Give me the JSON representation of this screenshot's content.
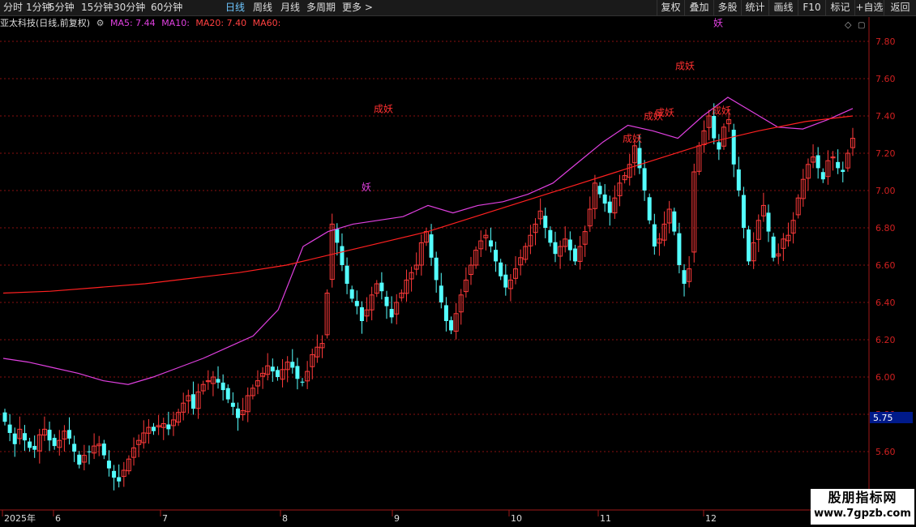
{
  "toolbar": {
    "periods": [
      "分时",
      "1分钟",
      "5分钟",
      "15分钟",
      "30分钟",
      "60分钟",
      "日线",
      "周线",
      "月线",
      "多周期",
      "更多 >"
    ],
    "active_period": "日线",
    "right_buttons": [
      "复权",
      "叠加",
      "多股",
      "统计",
      "画线",
      "F10",
      "标记",
      "+自选",
      "返回"
    ]
  },
  "title": {
    "stock": "亚太科技(日线,前复权)",
    "ma5": "MA5: 7.44",
    "ma10": "MA10:",
    "ma20": "MA20: 7.40",
    "ma60": "MA60:"
  },
  "colors": {
    "up": "#ff3a3a",
    "down": "#54ffff",
    "ma_pink": "#e040e0",
    "ma_red": "#ff2020",
    "grid": "#8a1010",
    "axis_text": "#d02020"
  },
  "price_axis": {
    "ticks": [
      "7.80",
      "7.60",
      "7.40",
      "7.20",
      "7.00",
      "6.80",
      "6.60",
      "6.40",
      "6.20",
      "6.00",
      "5.80",
      "5.60"
    ],
    "current": "5.75"
  },
  "time_axis": [
    "2025年",
    "6",
    "7",
    "8",
    "9",
    "10",
    "11",
    "12"
  ],
  "signals": [
    {
      "text": "妖",
      "date": "8月末",
      "price": 7.0,
      "color": "#e040e0"
    },
    {
      "text": "成妖",
      "date": "9月初",
      "price": 7.42,
      "color": "#ff3030"
    },
    {
      "text": "成妖",
      "date": "11月中",
      "price": 7.26,
      "color": "#ff3030"
    },
    {
      "text": "成妖",
      "date": "11月中",
      "price": 7.38,
      "color": "#ff3030"
    },
    {
      "text": "成妖",
      "date": "11月中",
      "price": 7.4,
      "color": "#ff3030"
    },
    {
      "text": "成妖",
      "date": "11月下",
      "price": 7.65,
      "color": "#ff3030"
    },
    {
      "text": "成妖",
      "date": "12月初",
      "price": 7.41,
      "color": "#ff3030"
    },
    {
      "text": "妖",
      "date": "12月初",
      "price": 7.88,
      "color": "#e040e0"
    }
  ],
  "chart_data": {
    "type": "candlestick",
    "ylim": [
      5.45,
      7.92
    ],
    "start_price": 5.84,
    "closes": [
      5.76,
      5.7,
      5.64,
      5.72,
      5.66,
      5.62,
      5.61,
      5.69,
      5.72,
      5.66,
      5.63,
      5.66,
      5.71,
      5.67,
      5.6,
      5.53,
      5.58,
      5.6,
      5.63,
      5.64,
      5.58,
      5.51,
      5.46,
      5.44,
      5.5,
      5.56,
      5.62,
      5.66,
      5.7,
      5.73,
      5.71,
      5.74,
      5.75,
      5.72,
      5.77,
      5.81,
      5.86,
      5.9,
      5.83,
      5.92,
      5.96,
      5.98,
      6.0,
      5.97,
      5.93,
      5.88,
      5.84,
      5.78,
      5.82,
      5.9,
      5.94,
      5.98,
      6.02,
      6.06,
      6.03,
      6.0,
      6.04,
      6.08,
      6.05,
      5.99,
      5.97,
      6.03,
      6.12,
      6.16,
      6.18,
      6.45,
      6.82,
      6.72,
      6.6,
      6.5,
      6.42,
      6.38,
      6.3,
      6.36,
      6.44,
      6.5,
      6.46,
      6.38,
      6.32,
      6.4,
      6.45,
      6.52,
      6.56,
      6.6,
      6.72,
      6.78,
      6.64,
      6.52,
      6.4,
      6.3,
      6.25,
      6.34,
      6.44,
      6.52,
      6.6,
      6.68,
      6.73,
      6.76,
      6.7,
      6.62,
      6.54,
      6.48,
      6.52,
      6.58,
      6.64,
      6.7,
      6.76,
      6.82,
      6.89,
      6.8,
      6.72,
      6.66,
      6.7,
      6.74,
      6.68,
      6.62,
      6.7,
      6.78,
      6.9,
      7.04,
      6.98,
      6.93,
      6.88,
      6.96,
      7.04,
      7.08,
      7.14,
      7.24,
      7.12,
      7.0,
      6.84,
      6.7,
      6.74,
      6.82,
      6.9,
      6.78,
      6.6,
      6.5,
      6.58,
      7.1,
      7.24,
      7.32,
      7.4,
      7.28,
      7.22,
      7.34,
      7.38,
      7.14,
      7.0,
      6.8,
      6.62,
      6.72,
      6.84,
      6.92,
      6.78,
      6.64,
      6.66,
      6.74,
      6.76,
      6.84,
      6.96,
      7.06,
      7.14,
      7.18,
      7.12,
      7.06,
      7.16,
      7.18,
      7.12,
      7.1,
      7.2,
      7.28
    ],
    "ma_pink": [
      6.1,
      6.08,
      6.05,
      6.02,
      5.98,
      5.96,
      6.0,
      6.05,
      6.1,
      6.16,
      6.22,
      6.36,
      6.7,
      6.78,
      6.82,
      6.84,
      6.86,
      6.92,
      6.88,
      6.92,
      6.94,
      6.98,
      7.04,
      7.15,
      7.26,
      7.35,
      7.32,
      7.28,
      7.4,
      7.5,
      7.42,
      7.34,
      7.33,
      7.38,
      7.44
    ],
    "ma_red": [
      6.45,
      6.46,
      6.48,
      6.5,
      6.53,
      6.56,
      6.6,
      6.66,
      6.72,
      6.78,
      6.86,
      6.94,
      7.02,
      7.1,
      7.18,
      7.26,
      7.32,
      7.37,
      7.4
    ]
  }
}
